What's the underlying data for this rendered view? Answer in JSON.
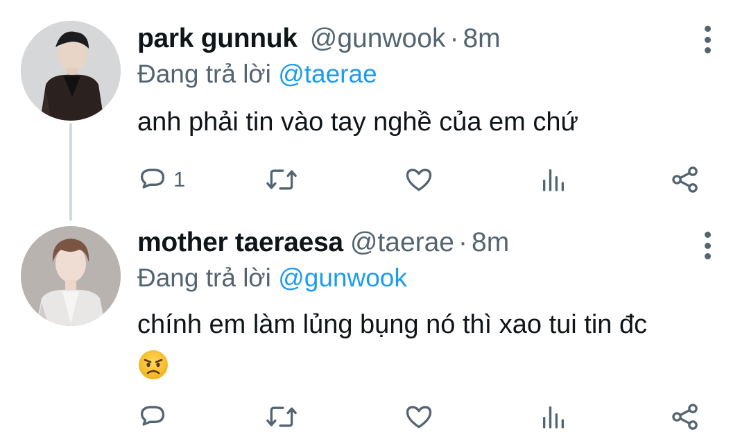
{
  "tweets": [
    {
      "display_name": "park gunnuk",
      "handle": "@gunwook",
      "separator": "·",
      "time": "8m",
      "replying_prefix": "Đang trả lời",
      "replying_to": "@taerae",
      "text": "anh phải tin vào tay nghề của em chứ",
      "reply_count": "1",
      "avatar_icon": "avatar-photo"
    },
    {
      "display_name": "mother taeraesa",
      "handle": "@taerae",
      "separator": "·",
      "time": "8m",
      "replying_prefix": "Đang trả lời",
      "replying_to": "@gunwook",
      "text": "chính em làm lủng bụng nó thì xao tui tin đc",
      "emoji_icon": "angry-face-emoji",
      "reply_count": "",
      "avatar_icon": "avatar-photo"
    }
  ],
  "colors": {
    "text_primary": "#0f1419",
    "text_secondary": "#536471",
    "link": "#1d9bf0",
    "thread_line": "#cfd9de"
  },
  "icons": [
    "reply-icon",
    "retweet-icon",
    "like-icon",
    "views-icon",
    "share-icon",
    "more-options-icon"
  ]
}
